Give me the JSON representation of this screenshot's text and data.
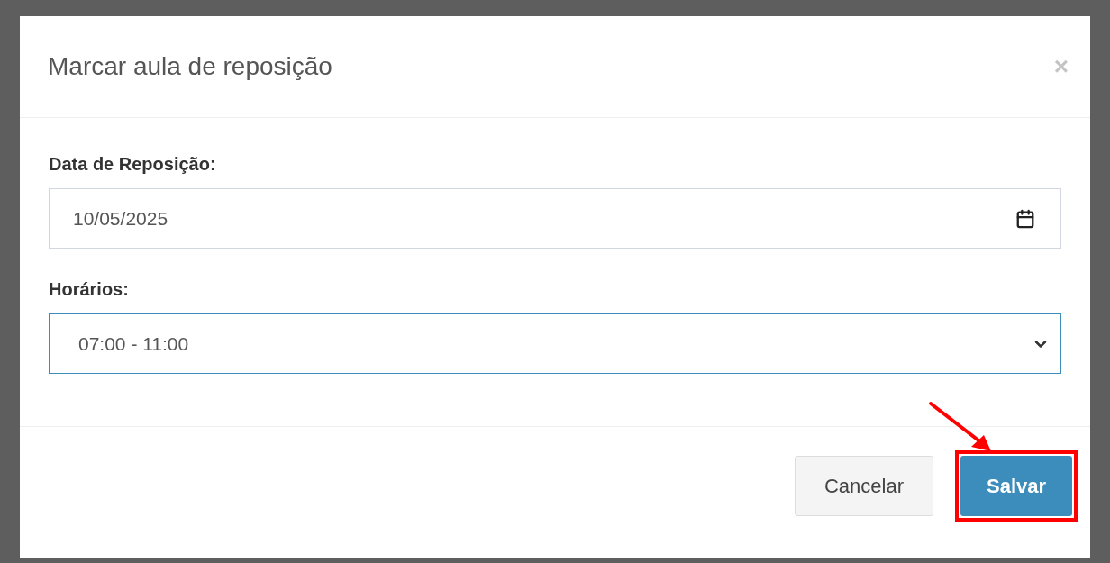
{
  "modal": {
    "title": "Marcar aula de reposição",
    "close": "×",
    "fields": [
      {
        "kind": "date",
        "label": "Data de Reposição:",
        "value": "10/05/2025",
        "focused": false
      },
      {
        "kind": "select",
        "label": "Horários:",
        "value": "07:00 - 11:00",
        "focused": true
      }
    ],
    "buttons": [
      {
        "label": "Cancelar",
        "primary": false,
        "highlighted": false
      },
      {
        "label": "Salvar",
        "primary": true,
        "highlighted": true
      }
    ]
  }
}
